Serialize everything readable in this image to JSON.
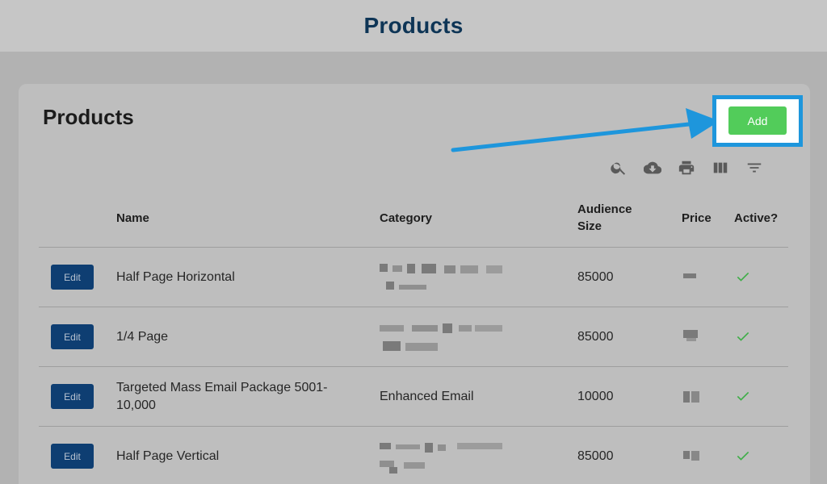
{
  "header": {
    "title": "Products"
  },
  "card": {
    "title": "Products",
    "add_label": "Add"
  },
  "toolbar": {
    "icons": [
      "search-icon",
      "download-icon",
      "print-icon",
      "columns-icon",
      "filter-icon"
    ]
  },
  "table": {
    "columns": {
      "name": "Name",
      "category": "Category",
      "audience_line1": "Audience",
      "audience_line2": "Size",
      "price": "Price",
      "active": "Active?"
    },
    "edit_label": "Edit",
    "rows": [
      {
        "name": "Half Page Horizontal",
        "category": "",
        "audience": "85000",
        "active": true
      },
      {
        "name": "1/4 Page",
        "category": "",
        "audience": "85000",
        "active": true
      },
      {
        "name": "Targeted Mass Email Package 5001-10,000",
        "category": "Enhanced Email",
        "audience": "10000",
        "active": true
      },
      {
        "name": "Half Page Vertical",
        "category": "",
        "audience": "85000",
        "active": true
      }
    ]
  },
  "colors": {
    "header_text": "#0e3556",
    "add_button": "#52cc5a",
    "highlight_border": "#1e96dc",
    "edit_button": "#0e3e72",
    "check": "#3fae48"
  }
}
